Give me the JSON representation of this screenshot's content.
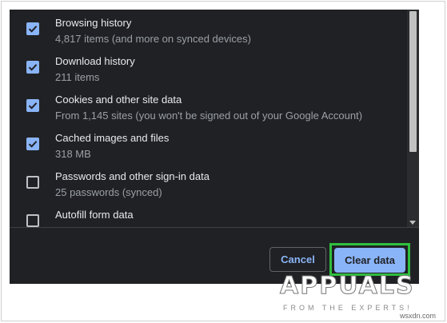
{
  "items": [
    {
      "title": "Browsing history",
      "subtitle": "4,817 items (and more on synced devices)",
      "checked": true
    },
    {
      "title": "Download history",
      "subtitle": "211 items",
      "checked": true
    },
    {
      "title": "Cookies and other site data",
      "subtitle": "From 1,145 sites (you won't be signed out of your Google Account)",
      "checked": true
    },
    {
      "title": "Cached images and files",
      "subtitle": "318 MB",
      "checked": true
    },
    {
      "title": "Passwords and other sign-in data",
      "subtitle": "25 passwords (synced)",
      "checked": false
    },
    {
      "title": "Autofill form data",
      "subtitle": "",
      "checked": false
    }
  ],
  "buttons": {
    "cancel": "Cancel",
    "clear": "Clear data"
  },
  "logo": {
    "main": "APPUALS",
    "sub": "FROM THE EXPERTS!"
  },
  "watermark": "wsxdn.com",
  "colors": {
    "dialog_bg": "#202124",
    "accent": "#8ab4f8",
    "highlight": "#2fbf3f"
  }
}
